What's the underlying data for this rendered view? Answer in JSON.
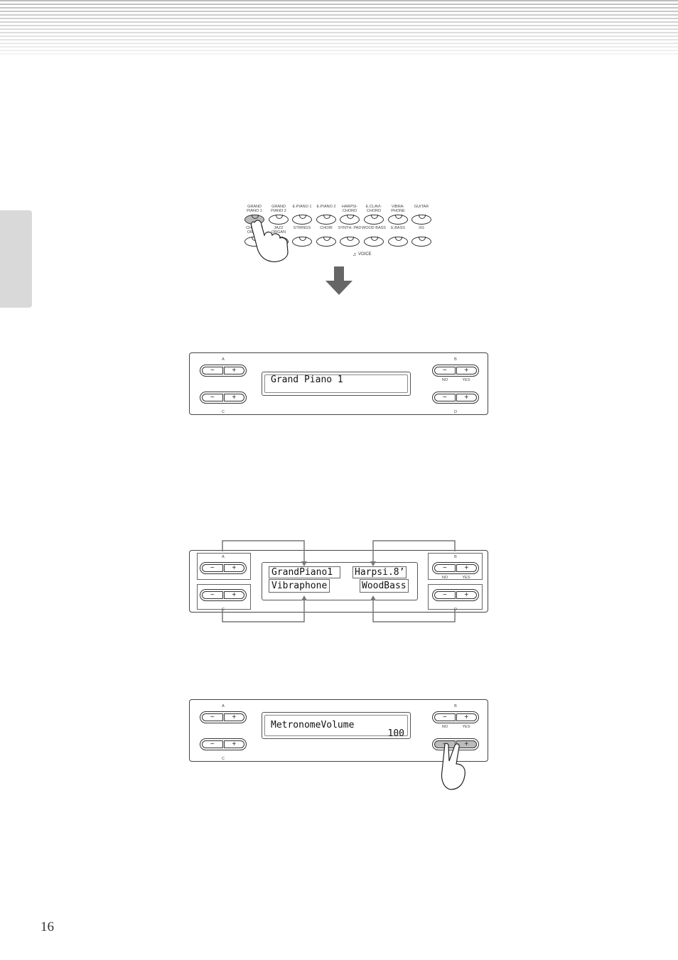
{
  "page_number": "16",
  "voice_panel": {
    "row1": [
      "GRAND PIANO 1",
      "GRAND PIANO 2",
      "E.PIANO 1",
      "E.PIANO 2",
      "HARPSI-CHORD",
      "E.CLAVI-CHORD",
      "VIBRA-PHONE",
      "GUITAR"
    ],
    "row2": [
      "CHURCH ORGAN",
      "JAZZ ORGAN",
      "STRINGS",
      "CHOIR",
      "SYNTH. PAD",
      "WOOD BASS",
      "E.BASS",
      "XG"
    ],
    "selected": "GRAND PIANO 1",
    "group_label": "VOICE"
  },
  "panel_labels": {
    "a": "A",
    "b": "B",
    "c": "C",
    "d": "D",
    "no": "NO",
    "yes": "YES",
    "minus": "−",
    "plus": "+"
  },
  "display1": {
    "line1": "Grand Piano 1"
  },
  "display2": {
    "a": "GrandPiano1",
    "b": "Harpsi.8’",
    "c": "Vibraphone",
    "d": "WoodBass"
  },
  "display3": {
    "line1": "MetronomeVolume",
    "value": "100"
  }
}
